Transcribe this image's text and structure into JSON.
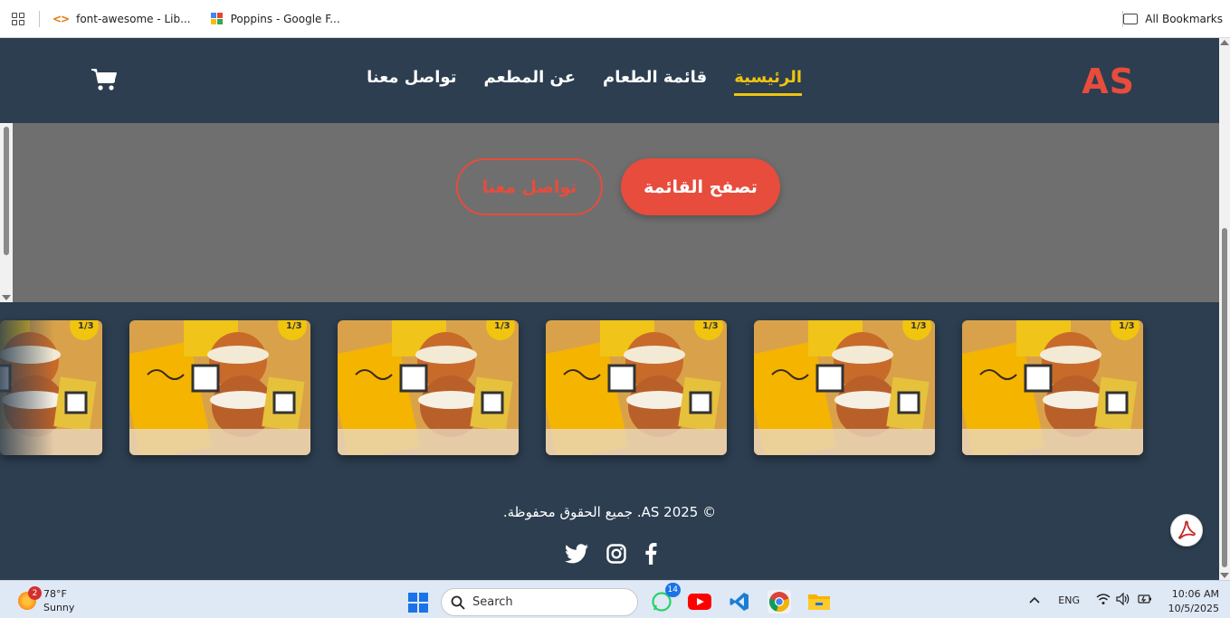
{
  "bookmarks": {
    "items": [
      {
        "label": "font-awesome - Lib..."
      },
      {
        "label": "Poppins - Google F..."
      }
    ],
    "all_bookmarks": "All Bookmarks"
  },
  "nav": {
    "logo": "AS",
    "links": [
      {
        "label": "الرئيسية",
        "active": true
      },
      {
        "label": "قائمة الطعام",
        "active": false
      },
      {
        "label": "عن المطعم",
        "active": false
      },
      {
        "label": "تواصل معنا",
        "active": false
      }
    ],
    "cart_icon": "shopping-cart-icon"
  },
  "hero": {
    "primary_button": "تصفح القائمة",
    "secondary_button": "تواصل معنا"
  },
  "gallery": {
    "tiles": 6,
    "badge_text": "1/3"
  },
  "footer": {
    "copyright": "© AS 2025. جميع الحقوق محفوظة.",
    "social_icons": [
      "twitter-icon",
      "instagram-icon",
      "facebook-icon"
    ]
  },
  "taskbar": {
    "weather_temp": "78°F",
    "weather_desc": "Sunny",
    "weather_badge": "2",
    "search_placeholder": "Search",
    "whatsapp_badge": "14",
    "language": "ENG",
    "time": "10:06 AM",
    "date": "10/5/2025"
  },
  "colors": {
    "nav_bg": "#2c3e50",
    "accent": "#e74c3c",
    "active_link": "#f1c40f",
    "hero_bg": "#6f6f6f"
  }
}
